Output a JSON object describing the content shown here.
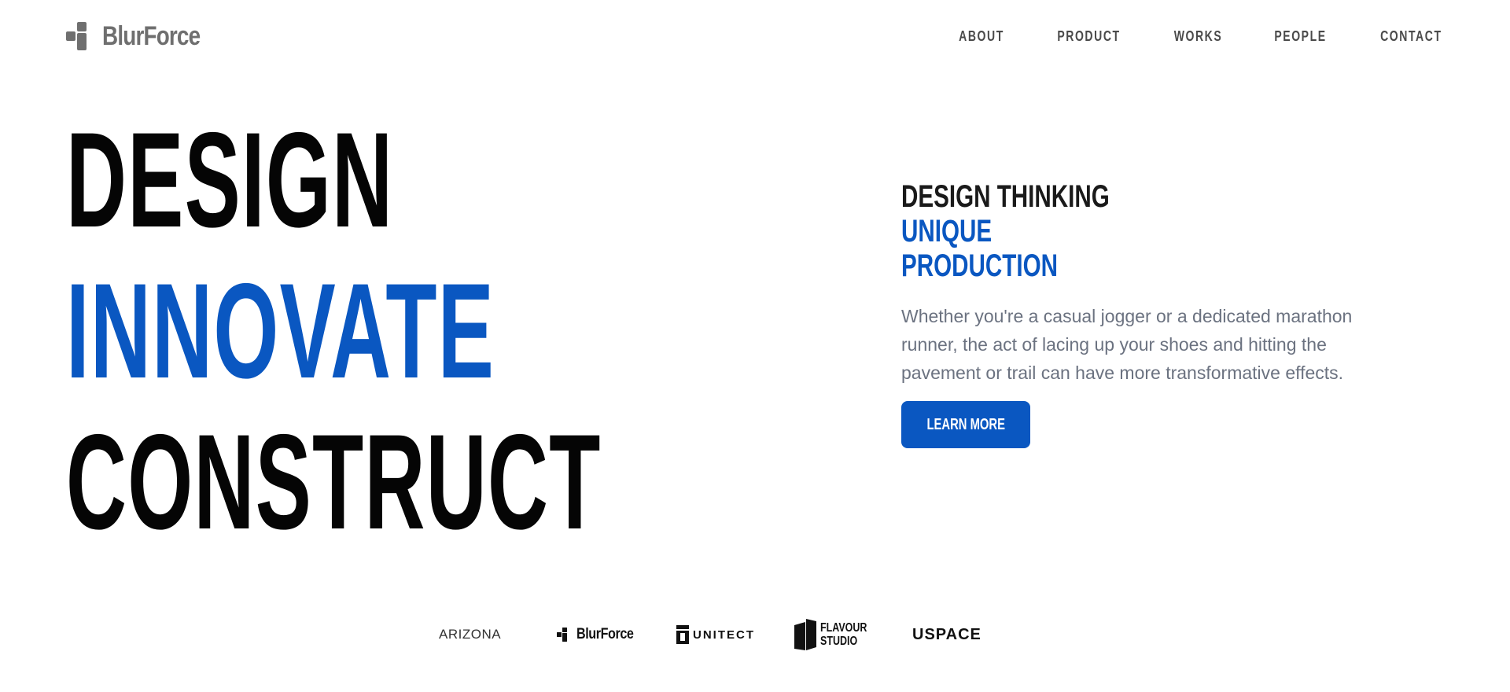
{
  "header": {
    "logo_text": "BlurForce",
    "logo_icon": "blocks-icon",
    "nav": [
      {
        "label": "ABOUT"
      },
      {
        "label": "PRODUCT"
      },
      {
        "label": "WORKS"
      },
      {
        "label": "PEOPLE"
      },
      {
        "label": "CONTACT"
      }
    ]
  },
  "hero": {
    "words": [
      "DESIGN",
      "INNOVATE",
      "CONSTRUCT"
    ]
  },
  "intro": {
    "line1": "DESIGN THINKING",
    "line2": "UNIQUE",
    "line3": "PRODUCTION",
    "description": "Whether you're a casual jogger or a dedicated marathon runner, the act of lacing up your shoes and hitting the pavement or trail can have more transformative effects.",
    "cta_label": "LEARN MORE"
  },
  "partners": {
    "arizona": "ARIZONA",
    "blurforce": "BlurForce",
    "unitect": "UNITECT",
    "flavour_line1": "FLAVOUR",
    "flavour_line2": "STUDIO",
    "uspace": "USPACE"
  },
  "colors": {
    "accent": "#0a57c1",
    "text_dark": "#050505",
    "text_muted": "#6b7280",
    "logo_gray": "#6f6f6f"
  }
}
